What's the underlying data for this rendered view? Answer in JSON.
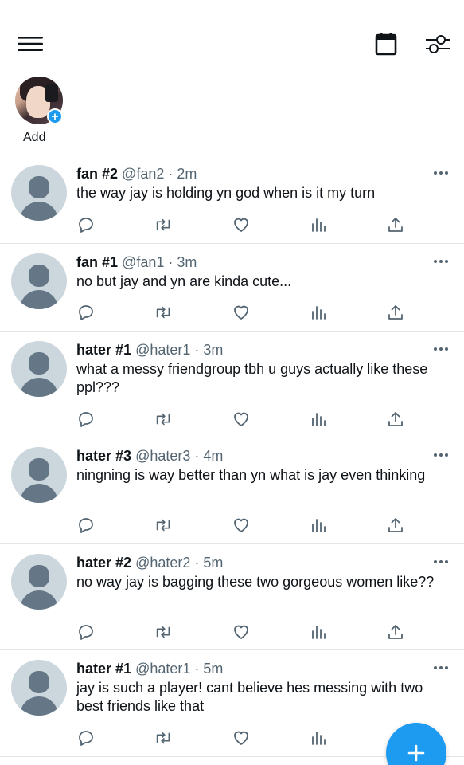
{
  "header": {
    "menu_icon": "hamburger-icon",
    "calendar_icon": "calendar-icon",
    "filter_icon": "sliders-icon"
  },
  "fleets": {
    "add_label": "Add",
    "add_badge": "+"
  },
  "tweets": [
    {
      "name": "fan #2",
      "handle": "@fan2",
      "time": "2m",
      "text": "the way jay is holding yn god when is it my turn"
    },
    {
      "name": "fan #1",
      "handle": "@fan1",
      "time": "3m",
      "text": "no but jay and yn are kinda cute..."
    },
    {
      "name": "hater #1",
      "handle": "@hater1",
      "time": "3m",
      "text": "what a messy friendgroup tbh u guys actually like these ppl???"
    },
    {
      "name": "hater #3",
      "handle": "@hater3",
      "time": "4m",
      "text": "ningning is way better than yn what is jay even thinking"
    },
    {
      "name": "hater #2",
      "handle": "@hater2",
      "time": "5m",
      "text": "no way jay is bagging these two gorgeous women like??"
    },
    {
      "name": "hater #1",
      "handle": "@hater1",
      "time": "5m",
      "text": "jay is such a player! cant believe hes messing with two best friends like that"
    }
  ],
  "meta_separator": "·",
  "compose": {
    "icon": "plus-icon",
    "label": "+"
  },
  "colors": {
    "accent": "#1d9bf0",
    "secondary_text": "#536471",
    "icon_gray": "#536471"
  }
}
